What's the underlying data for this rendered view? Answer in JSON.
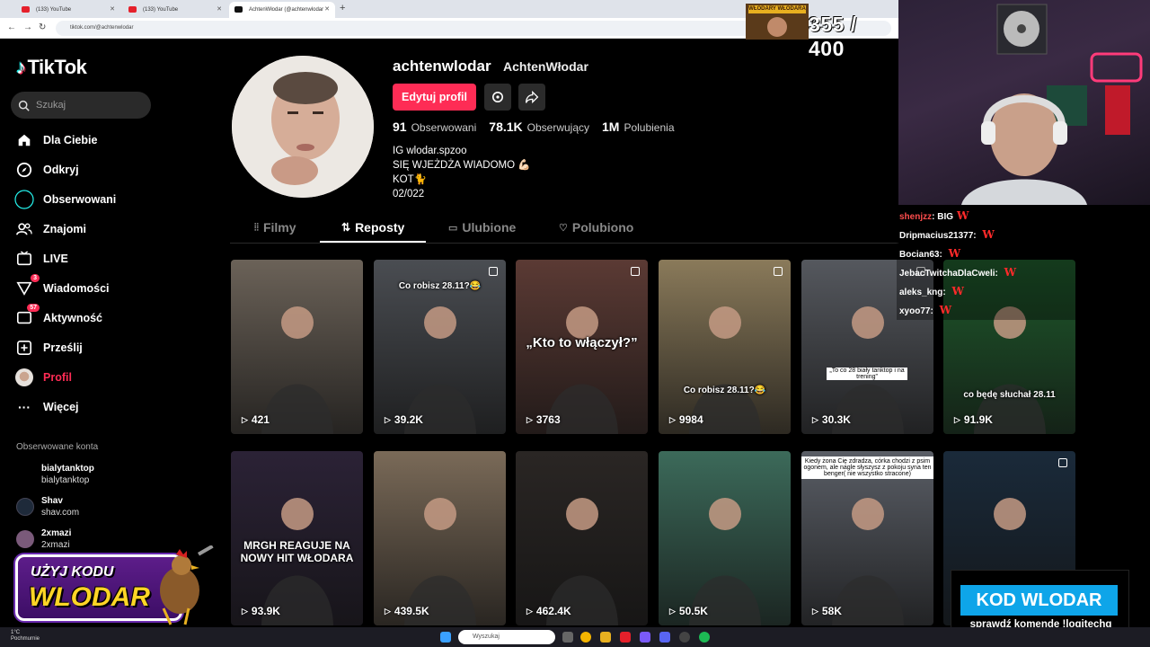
{
  "browser": {
    "tabs": [
      {
        "label": "(133) YouTube",
        "kind": "youtube"
      },
      {
        "label": "(133) YouTube",
        "kind": "youtube"
      },
      {
        "label": "AchtenWłodar (@achtenwlodar",
        "kind": "tiktok"
      }
    ],
    "url": "tiktok.com/@achtenwlodar"
  },
  "sidebar": {
    "logo": "TikTok",
    "search_placeholder": "Szukaj",
    "items": [
      {
        "label": "Dla Ciebie",
        "icon": "home-icon"
      },
      {
        "label": "Odkryj",
        "icon": "compass-icon"
      },
      {
        "label": "Obserwowani",
        "icon": "following-icon"
      },
      {
        "label": "Znajomi",
        "icon": "friends-icon"
      },
      {
        "label": "LIVE",
        "icon": "live-icon"
      },
      {
        "label": "Wiadomości",
        "icon": "messages-icon",
        "badge": "3"
      },
      {
        "label": "Aktywność",
        "icon": "activity-icon",
        "badge": "57"
      },
      {
        "label": "Prześlij",
        "icon": "upload-icon"
      },
      {
        "label": "Profil",
        "icon": "profile-avatar"
      },
      {
        "label": "Więcej",
        "icon": "more-icon"
      }
    ],
    "followed_heading": "Obserwowane konta",
    "followed": [
      {
        "name": "bialytanktop",
        "handle": "bialytanktop"
      },
      {
        "name": "Shav",
        "handle": "shav.com"
      },
      {
        "name": "2xmazi",
        "handle": "2xmazi"
      }
    ]
  },
  "promo": {
    "line1": "UŻYJ KODU",
    "line2": "WLODAR"
  },
  "profile": {
    "username": "achtenwlodar",
    "nickname": "AchtenWłodar",
    "edit_label": "Edytuj profil",
    "stats": [
      {
        "value": "91",
        "label": "Obserwowani"
      },
      {
        "value": "78.1K",
        "label": "Obserwujący"
      },
      {
        "value": "1M",
        "label": "Polubienia"
      }
    ],
    "bio": [
      "IG wlodar.spzoo",
      "SIĘ WJEŻDŻA WIADOMO 💪🏻",
      "KOT🐈",
      "02/022"
    ]
  },
  "tabs": [
    "Filmy",
    "Reposty",
    "Ulubione",
    "Polubiono"
  ],
  "active_tab": "Reposty",
  "videos": [
    {
      "views": "421",
      "caption": "",
      "bg": "#6b6258"
    },
    {
      "views": "39.2K",
      "caption": "Co robisz 28.11?😂",
      "bg": "#4a4d52",
      "multi": true
    },
    {
      "views": "3763",
      "caption": "„Kto to włączył?”",
      "bg": "#5b3a34",
      "multi": true
    },
    {
      "views": "9984",
      "caption": "Co robisz 28.11?😂",
      "bg": "#8a7a5a",
      "multi": true
    },
    {
      "views": "30.3K",
      "caption": "„To co 28 biały tanktop i na trening”",
      "bg": "#55585e",
      "multi": true
    },
    {
      "views": "91.9K",
      "caption": "co będę słuchał 28.11",
      "bg": "#1f5a2c"
    },
    {
      "views": "93.9K",
      "caption": "MRGH REAGUJE NA NOWY HIT WŁODARA",
      "bg": "#2b2236"
    },
    {
      "views": "439.5K",
      "caption": "",
      "bg": "#7a6a58"
    },
    {
      "views": "462.4K",
      "caption": "",
      "bg": "#2a2624"
    },
    {
      "views": "50.5K",
      "caption": "",
      "bg": "#3c6a5a"
    },
    {
      "views": "58K",
      "caption": "Kiedy żona Cię zdradza, córka chodzi z psim ogonem, ale nagle słyszysz z pokoju syna ten benger( nie wszystko stracone)",
      "bg": "#5a5e66"
    },
    {
      "views": "",
      "caption": "",
      "bg": "#1a2a3a",
      "multi": true
    }
  ],
  "stream": {
    "counter": "355 / 400",
    "counter_banner": "WŁODARY WŁODARA",
    "chat": [
      {
        "user": "shenjzz",
        "msg": "BIG",
        "color": "#ff4d4d"
      },
      {
        "user": "Dripmacius21377",
        "msg": "",
        "color": "#ffffff"
      },
      {
        "user": "Bocian63",
        "msg": "",
        "color": "#ffffff"
      },
      {
        "user": "JebacTwitchaDlaCweli",
        "msg": "",
        "color": "#ffffff"
      },
      {
        "user": "aleks_kng",
        "msg": "",
        "color": "#ffffff"
      },
      {
        "user": "xyoo77",
        "msg": "",
        "color": "#ffffff"
      }
    ],
    "chat_reaction": "W",
    "code_banner": "KOD WLODAR",
    "code_sub": "sprawdź komendę !logitechg"
  },
  "taskbar": {
    "temp": "1°C",
    "weather": "Pochmurnie",
    "search": "Wyszukaj"
  },
  "colors": {
    "accent": "#fe2c55",
    "bg": "#000000",
    "code": "#0ea5e9"
  }
}
